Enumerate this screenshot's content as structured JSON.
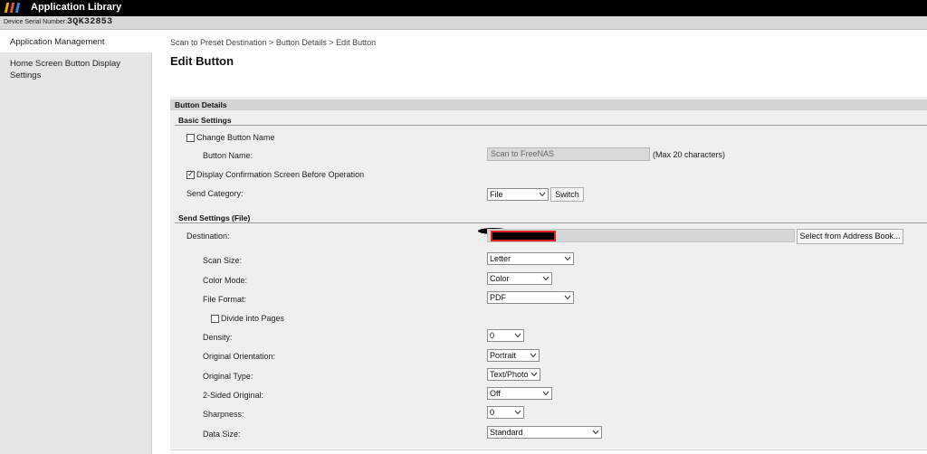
{
  "app": {
    "title": "Application Library"
  },
  "device": {
    "serial_label": "Device Serial Number:",
    "serial_value": "3QK32853"
  },
  "sidebar": {
    "items": [
      {
        "label": "Application Management"
      },
      {
        "label": "Home Screen Button Display Settings"
      }
    ]
  },
  "breadcrumb": "Scan to Preset Destination > Button Details > Edit Button",
  "page_title": "Edit Button",
  "button_details": {
    "header": "Button Details",
    "basic": {
      "header": "Basic Settings",
      "change_name_label": "Change Button Name",
      "change_name_checked": false,
      "button_name_label": "Button Name:",
      "button_name_value": "Scan to FreeNAS",
      "max_chars_hint": "(Max 20 characters)",
      "display_confirm_label": "Display Confirmation Screen Before Operation",
      "display_confirm_checked": true,
      "send_category_label": "Send Category:",
      "send_category_value": "File",
      "switch_label": "Switch"
    },
    "send": {
      "header": "Send Settings (File)",
      "destination_label": "Destination:",
      "address_book_label": "Select from Address Book...",
      "scan_size_label": "Scan Size:",
      "scan_size_value": "Letter",
      "color_mode_label": "Color Mode:",
      "color_mode_value": "Color",
      "file_format_label": "File Format:",
      "file_format_value": "PDF",
      "divide_pages_label": "Divide into Pages",
      "divide_pages_checked": false,
      "density_label": "Density:",
      "density_value": "0",
      "orientation_label": "Original Orientation:",
      "orientation_value": "Portrait",
      "original_type_label": "Original Type:",
      "original_type_value": "Text/Photo",
      "two_sided_label": "2-Sided Original:",
      "two_sided_value": "Off",
      "sharpness_label": "Sharpness:",
      "sharpness_value": "0",
      "data_size_label": "Data Size:",
      "data_size_value": "Standard"
    }
  },
  "colors": {
    "logo_bars": [
      "#f2a900",
      "#e4572e",
      "#2e86de"
    ],
    "redaction_border": "#e02020"
  }
}
